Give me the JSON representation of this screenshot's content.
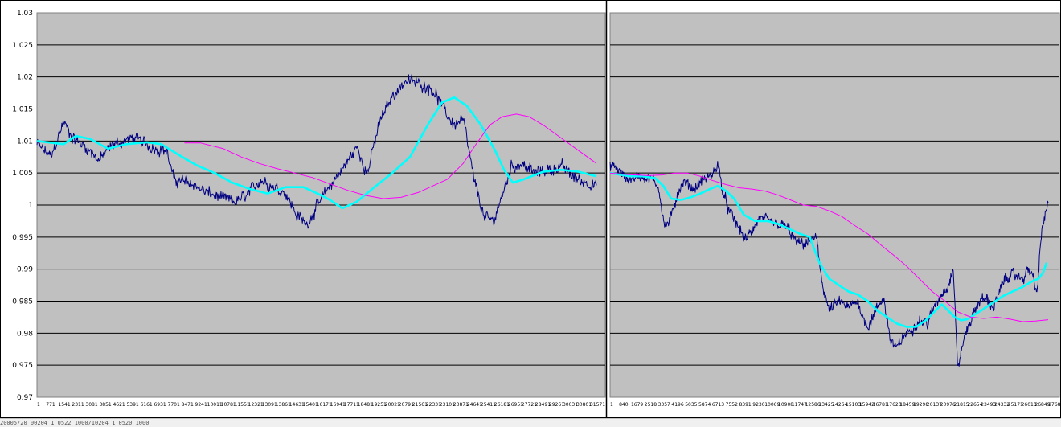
{
  "colors": {
    "plot_bg": "#c0c0c0",
    "price": "#000080",
    "fast_ma": "#00ffff",
    "slow_ma": "#ff00ff",
    "grid": "#000000"
  },
  "chart_data": [
    {
      "type": "line",
      "ylim": [
        0.97,
        1.03
      ],
      "y_ticks": [
        "1.03",
        "1.025",
        "1.02",
        "1.015",
        "1.01",
        "1.005",
        "1",
        "0.995",
        "0.99",
        "0.985",
        "0.98",
        "0.975",
        "0.97"
      ],
      "x_ticks": [
        "1",
        "771",
        "1541",
        "2311",
        "3081",
        "3851",
        "4621",
        "5391",
        "6161",
        "6931",
        "7701",
        "8471",
        "9241",
        "10011",
        "10781",
        "11551",
        "12321",
        "13091",
        "13861",
        "14631",
        "15401",
        "16171",
        "16941",
        "17711",
        "18481",
        "19251",
        "20021",
        "20791",
        "21561",
        "22331",
        "23101",
        "23871",
        "24641",
        "25411",
        "26181",
        "26951",
        "27721",
        "28491",
        "29261",
        "30031",
        "30801",
        "31571"
      ],
      "x_max": 32000,
      "grid": "horizontal",
      "series": [
        {
          "key": "price",
          "noise": 0.0009,
          "x": [
            0,
            800,
            1500,
            2000,
            2800,
            3500,
            4300,
            5500,
            6500,
            7300,
            7700,
            8700,
            9500,
            10500,
            11200,
            11800,
            12600,
            13200,
            14000,
            14600,
            15200,
            15800,
            16500,
            17300,
            18000,
            18600,
            19300,
            20000,
            20800,
            21500,
            22300,
            23000,
            23500,
            24000,
            24600,
            25200,
            25700,
            26200,
            26700,
            27300,
            28000,
            28800,
            29600,
            30400,
            31000,
            31500
          ],
          "y": [
            1.0095,
            1.0075,
            1.013,
            1.0105,
            1.009,
            1.007,
            1.0095,
            1.0105,
            1.009,
            1.0085,
            1.004,
            1.0035,
            1.002,
            1.001,
            1.0005,
            1.0015,
            1.004,
            1.003,
            1.002,
            0.9985,
            0.997,
            1.0,
            1.003,
            1.006,
            1.009,
            1.005,
            1.013,
            1.017,
            1.0195,
            1.019,
            1.018,
            1.0145,
            1.0125,
            1.0135,
            1.004,
            0.998,
            0.9975,
            1.0015,
            1.006,
            1.0065,
            1.005,
            1.0055,
            1.006,
            1.004,
            1.0035,
            1.003
          ]
        },
        {
          "key": "fast_ma",
          "noise": 0,
          "x": [
            0,
            1500,
            2200,
            3000,
            4000,
            5000,
            6200,
            7000,
            8000,
            9000,
            10000,
            11000,
            12000,
            13000,
            14000,
            15000,
            15800,
            16500,
            17200,
            18000,
            19000,
            20000,
            21000,
            22000,
            22800,
            23500,
            24200,
            25000,
            25800,
            26300,
            26800,
            27400,
            28500,
            29500,
            30500,
            31500
          ],
          "y": [
            1.01,
            1.0095,
            1.0108,
            1.0103,
            1.0088,
            1.0095,
            1.0098,
            1.0095,
            1.0078,
            1.0062,
            1.005,
            1.0035,
            1.0025,
            1.0018,
            1.0028,
            1.0028,
            1.0018,
            1.0008,
            0.9995,
            1.0005,
            1.0028,
            1.005,
            1.0075,
            1.0125,
            1.016,
            1.0168,
            1.0155,
            1.0125,
            1.0085,
            1.0055,
            1.0035,
            1.004,
            1.0052,
            1.0055,
            1.0052,
            1.0045
          ]
        },
        {
          "key": "slow_ma",
          "noise": 0,
          "x": [
            8300,
            9200,
            10500,
            11500,
            12500,
            13500,
            14500,
            15500,
            16500,
            17500,
            18500,
            19500,
            20500,
            21500,
            22300,
            23100,
            24000,
            24800,
            25500,
            26200,
            27000,
            27700,
            28500,
            29500,
            30500,
            31500
          ],
          "y": [
            1.0097,
            1.0097,
            1.0088,
            1.0075,
            1.0065,
            1.0057,
            1.005,
            1.0043,
            1.0033,
            1.0023,
            1.0015,
            1.001,
            1.0012,
            1.002,
            1.003,
            1.004,
            1.0065,
            1.0098,
            1.0125,
            1.0138,
            1.0142,
            1.0138,
            1.0125,
            1.0105,
            1.0085,
            1.0065
          ]
        }
      ]
    },
    {
      "type": "line",
      "ylim": [
        0.97,
        1.03
      ],
      "y_ticks": [],
      "x_ticks": [
        "1",
        "840",
        "1679",
        "2518",
        "3357",
        "4196",
        "5035",
        "5874",
        "6713",
        "7552",
        "8391",
        "9230",
        "10069",
        "10908",
        "11747",
        "12586",
        "13425",
        "14264",
        "15103",
        "15942",
        "16781",
        "17620",
        "18459",
        "19298",
        "20137",
        "20976",
        "21815",
        "22654",
        "23493",
        "24332",
        "25171",
        "26010",
        "26849",
        "27688"
      ],
      "x_max": 27900,
      "grid": "horizontal",
      "series": [
        {
          "key": "price",
          "noise": 0.0008,
          "x": [
            0,
            300,
            1000,
            1800,
            2600,
            3000,
            3400,
            3800,
            4200,
            4600,
            5200,
            5800,
            6300,
            6700,
            7000,
            7400,
            7900,
            8400,
            8800,
            9300,
            9800,
            10400,
            11000,
            11600,
            12200,
            12800,
            13000,
            13200,
            13600,
            14200,
            14800,
            15400,
            15700,
            16000,
            16500,
            17000,
            17400,
            17800,
            18200,
            18700,
            19200,
            19700,
            20200,
            20700,
            21000,
            21300,
            21600,
            22000,
            22400,
            22900,
            23400,
            23800,
            24200,
            24500,
            24800,
            25200,
            25600,
            26000,
            26300,
            26500,
            26800,
            27200
          ],
          "y": [
            1.006,
            1.006,
            1.004,
            1.0045,
            1.004,
            1.003,
            0.9965,
            0.998,
            1.002,
            1.0035,
            1.0025,
            1.004,
            1.0045,
            1.0065,
            1.002,
            0.999,
            0.997,
            0.9945,
            0.996,
            0.998,
            0.9975,
            0.997,
            0.9965,
            0.994,
            0.994,
            0.995,
            0.991,
            0.9875,
            0.9835,
            0.985,
            0.984,
            0.985,
            0.9825,
            0.981,
            0.9835,
            0.9855,
            0.979,
            0.9775,
            0.9795,
            0.9805,
            0.982,
            0.9815,
            0.9845,
            0.9865,
            0.9875,
            0.99,
            0.9745,
            0.9795,
            0.982,
            0.985,
            0.9855,
            0.984,
            0.9865,
            0.9885,
            0.989,
            0.989,
            0.9885,
            0.99,
            0.9885,
            0.986,
            0.996,
            1.0005
          ]
        },
        {
          "key": "fast_ma",
          "noise": 0,
          "x": [
            0,
            500,
            1200,
            2000,
            2800,
            3300,
            3800,
            4400,
            5000,
            5600,
            6200,
            6700,
            7200,
            7700,
            8300,
            9000,
            9800,
            10500,
            11200,
            11800,
            12400,
            13000,
            13600,
            14200,
            14800,
            15400,
            16000,
            16600,
            17200,
            17800,
            18400,
            19000,
            19600,
            20200,
            20600,
            21000,
            21400,
            21800,
            22200,
            22700,
            23200,
            23800,
            24400,
            25000,
            25600,
            26000,
            26300,
            26600,
            26900,
            27100
          ],
          "y": [
            1.005,
            1.0048,
            1.0045,
            1.0045,
            1.0042,
            1.003,
            1.001,
            1.0008,
            1.0012,
            1.0018,
            1.0025,
            1.003,
            1.0022,
            1.001,
            0.9985,
            0.9975,
            0.9975,
            0.997,
            0.9962,
            0.9955,
            0.995,
            0.991,
            0.9885,
            0.9875,
            0.9865,
            0.986,
            0.985,
            0.9835,
            0.9825,
            0.9815,
            0.981,
            0.981,
            0.982,
            0.9835,
            0.9845,
            0.9835,
            0.9825,
            0.982,
            0.9822,
            0.983,
            0.9838,
            0.9848,
            0.9858,
            0.9865,
            0.9872,
            0.9878,
            0.9882,
            0.9885,
            0.9895,
            0.991
          ]
        },
        {
          "key": "slow_ma",
          "noise": 0,
          "x": [
            0,
            800,
            1600,
            2400,
            3200,
            4000,
            4800,
            5600,
            6400,
            7200,
            8000,
            8800,
            9600,
            10400,
            11200,
            12000,
            12800,
            13600,
            14400,
            15200,
            16000,
            16800,
            17600,
            18400,
            19200,
            20000,
            20800,
            21600,
            22400,
            23200,
            24000,
            24800,
            25600,
            26400,
            27200
          ],
          "y": [
            1.005,
            1.0048,
            1.0047,
            1.0046,
            1.0047,
            1.005,
            1.005,
            1.0045,
            1.0038,
            1.0032,
            1.0027,
            1.0025,
            1.0022,
            1.0016,
            1.0008,
            1.0,
            0.9998,
            0.9991,
            0.9982,
            0.9968,
            0.9955,
            0.9938,
            0.9922,
            0.9905,
            0.9885,
            0.9865,
            0.985,
            0.9833,
            0.9825,
            0.9823,
            0.9825,
            0.9822,
            0.9818,
            0.9819,
            0.9821
          ]
        }
      ]
    }
  ],
  "status_text": "20005/20 00204  1 0522 1000/10204  1 0520  1000"
}
